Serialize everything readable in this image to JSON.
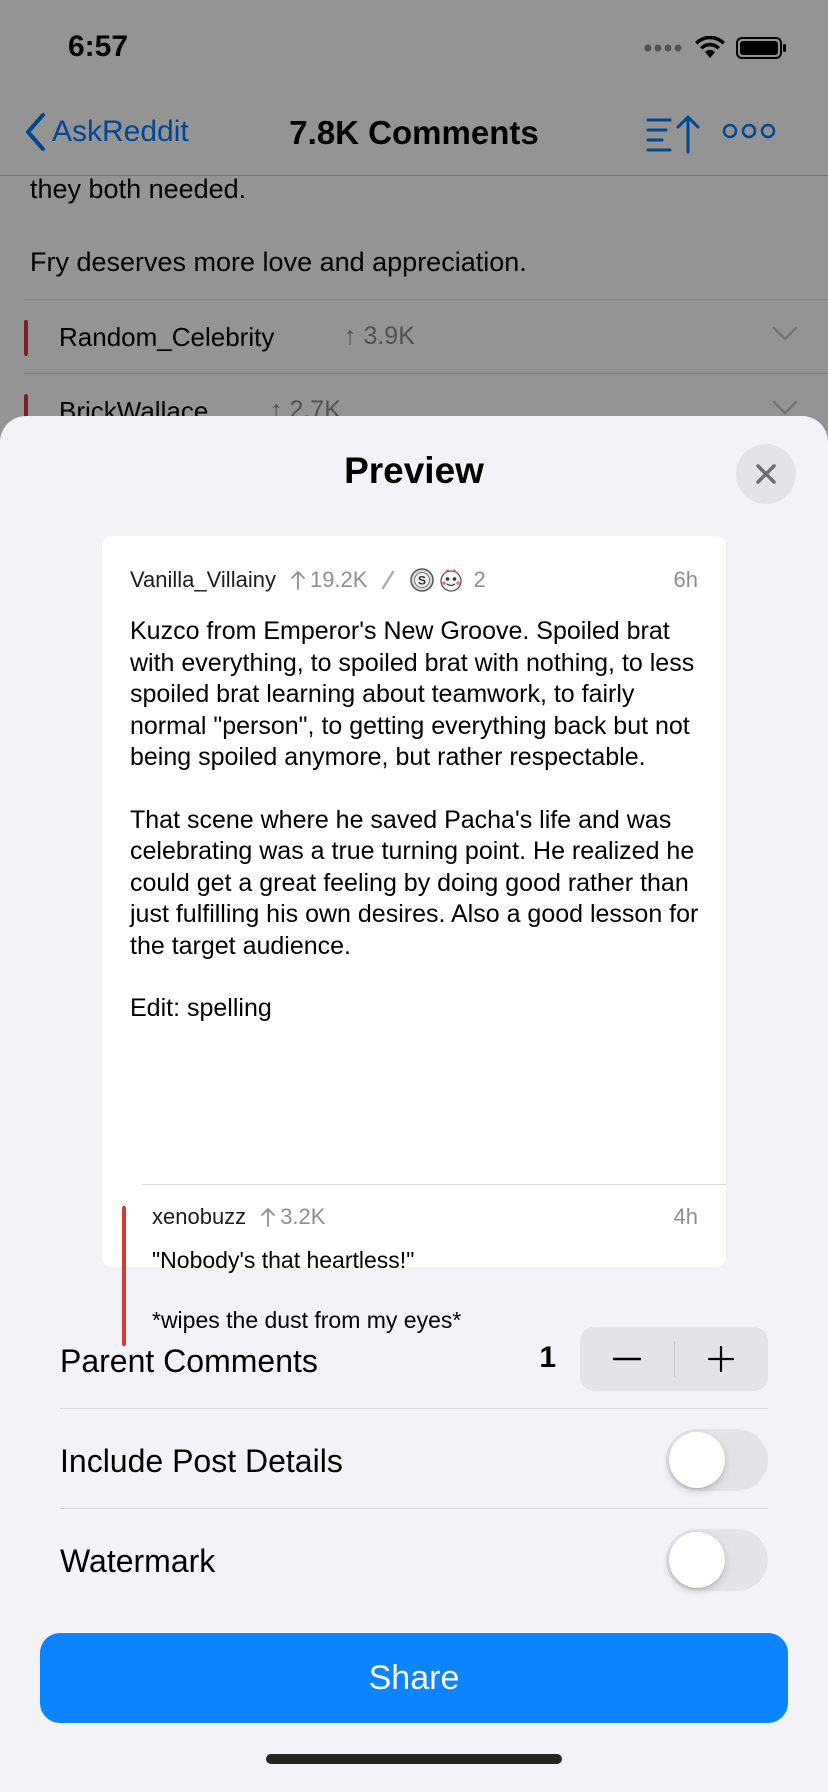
{
  "status_bar": {
    "time": "6:57",
    "icons": [
      "signal-dots-icon",
      "wifi-icon",
      "battery-icon"
    ]
  },
  "nav": {
    "back_label": "AskReddit",
    "title": "7.8K Comments",
    "icons": [
      "chevron-left-icon",
      "sort-icon",
      "more-icon"
    ]
  },
  "background_thread": {
    "text_lines": [
      "they both needed.",
      "Fry deserves more love and appreciation."
    ],
    "comments": [
      {
        "author": "Random_Celebrity",
        "score": "3.9K"
      },
      {
        "author": "BrickWallace",
        "score": "2.7K"
      }
    ]
  },
  "sheet": {
    "title": "Preview",
    "close_icon": "close-icon"
  },
  "preview": {
    "comment": {
      "author": "Vanilla_Villainy",
      "score": "19.2K",
      "award_count": "2",
      "age": "6h",
      "paragraphs": [
        "Kuzco from Emperor's New Groove. Spoiled brat with everything, to spoiled brat with nothing, to less spoiled brat learning about teamwork, to fairly normal \"person\", to getting everything back but not being spoiled anymore, but rather respectable.",
        "That scene where he saved Pacha's life and was celebrating was a true turning point. He realized he could get a great feeling by doing good rather than just fulfilling his own desires. Also a good lesson for the target audience.",
        "Edit: spelling"
      ]
    },
    "reply": {
      "author": "xenobuzz",
      "score": "3.2K",
      "age": "4h",
      "paragraphs": [
        "\"Nobody's that heartless!\"",
        "*wipes the dust from my eyes*"
      ]
    }
  },
  "options": {
    "parent_comments_label": "Parent Comments",
    "parent_comments_value": "1",
    "include_post_details_label": "Include Post Details",
    "include_post_details_on": false,
    "watermark_label": "Watermark",
    "watermark_on": false
  },
  "share_label": "Share",
  "colors": {
    "accent": "#0a84ff",
    "thread_bar": "#d33a3a"
  }
}
